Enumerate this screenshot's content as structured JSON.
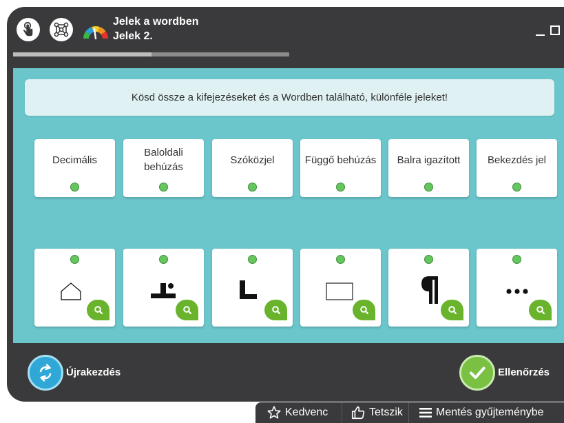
{
  "header": {
    "title": "Jelek a wordben",
    "subtitle": "Jelek 2.",
    "progress": 0.5,
    "icons": [
      "touch-icon",
      "connect-nodes-icon",
      "difficulty-gauge-icon"
    ]
  },
  "instruction": "Kösd össze a kifejezéseket és a Wordben található, különféle jeleket!",
  "word_cards": [
    {
      "label": "Decimális"
    },
    {
      "label": "Baloldali behúzás"
    },
    {
      "label": "Szóközjel"
    },
    {
      "label": "Függő behúzás"
    },
    {
      "label": "Balra igazított"
    },
    {
      "label": "Bekezdés jel"
    }
  ],
  "symbol_cards": [
    {
      "icon": "house-tab-icon"
    },
    {
      "icon": "decimal-tab-icon"
    },
    {
      "icon": "left-tab-icon"
    },
    {
      "icon": "rectangle-icon"
    },
    {
      "icon": "pilcrow-icon"
    },
    {
      "icon": "ellipsis-icon"
    }
  ],
  "footer": {
    "restart_label": "Újrakezdés",
    "check_label": "Ellenőrzés"
  },
  "actions": {
    "favorite": "Kedvenc",
    "like": "Tetszik",
    "save": "Mentés gyűjteménybe"
  },
  "colors": {
    "frame": "#3a3a3c",
    "board": "#6bc6cc",
    "instruction_bg": "#dff1f2",
    "dot_green": "#64c65d",
    "zoom_green": "#6ab42d",
    "restart_blue": "#30a8d7",
    "check_green": "#7ac143"
  }
}
